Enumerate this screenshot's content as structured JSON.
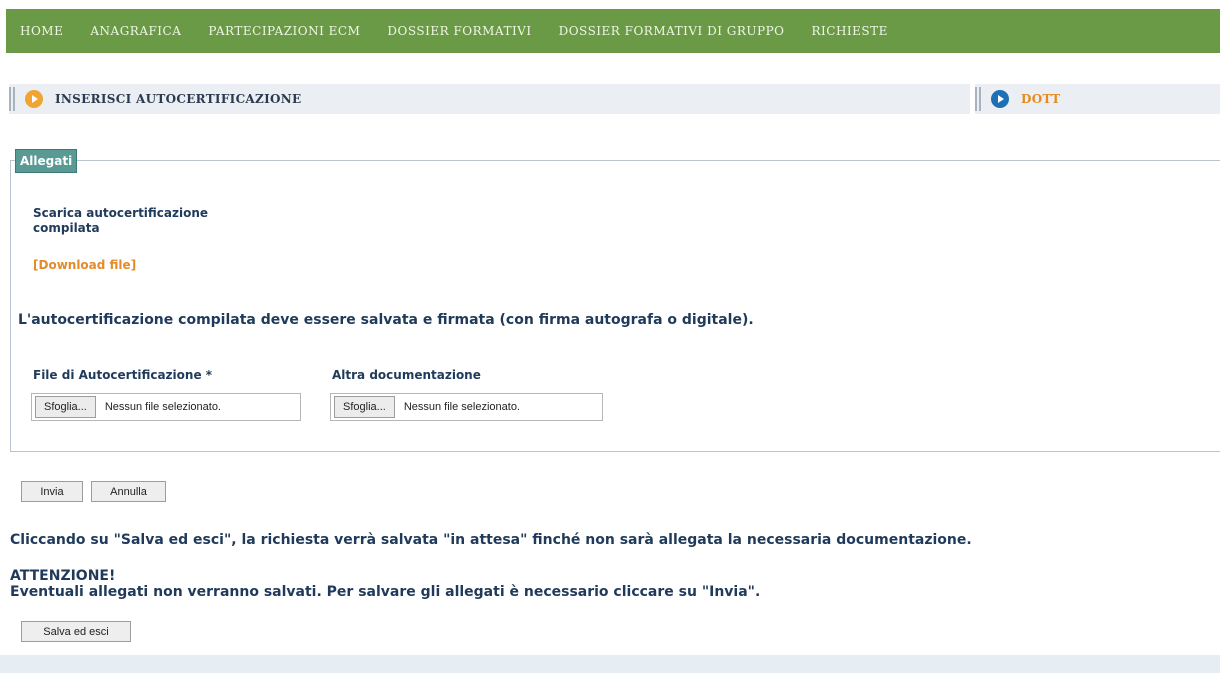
{
  "nav": {
    "items": [
      {
        "label": "HOME"
      },
      {
        "label": "ANAGRAFICA"
      },
      {
        "label": "PARTECIPAZIONI ECM"
      },
      {
        "label": "DOSSIER FORMATIVI"
      },
      {
        "label": "DOSSIER FORMATIVI DI GRUPPO"
      },
      {
        "label": "RICHIESTE"
      }
    ]
  },
  "title_left": "INSERISCI AUTOCERTIFICAZIONE",
  "title_right": "DOTT",
  "colors": {
    "nav_bg": "#6b9a47",
    "accent_orange": "#f0a533",
    "accent_blue": "#1f6fb6",
    "legend_bg": "#5a9a95",
    "link": "#e38b2a"
  },
  "allegati": {
    "legend": "Allegati",
    "scarica_label": "Scarica autocertificazione compilata",
    "download_link": "[Download file]",
    "notice": "L'autocertificazione compilata deve essere salvata e firmata (con firma autografa o digitale).",
    "file_autocert": {
      "label": "File di Autocertificazione *",
      "button": "Sfoglia...",
      "status": "Nessun file selezionato."
    },
    "altra_doc": {
      "label": "Altra documentazione",
      "button": "Sfoglia...",
      "status": "Nessun file selezionato."
    }
  },
  "actions": {
    "invia": "Invia",
    "annulla": "Annulla"
  },
  "info": {
    "salva_text": "Cliccando su \"Salva ed esci\", la richiesta verrà salvata \"in attesa\" finché non sarà allegata la necessaria documentazione.",
    "attenzione": "ATTENZIONE!",
    "allegati_warning": "Eventuali allegati non verranno salvati. Per salvare gli allegati è necessario cliccare su \"Invia\"."
  },
  "salva_button": "Salva ed esci"
}
